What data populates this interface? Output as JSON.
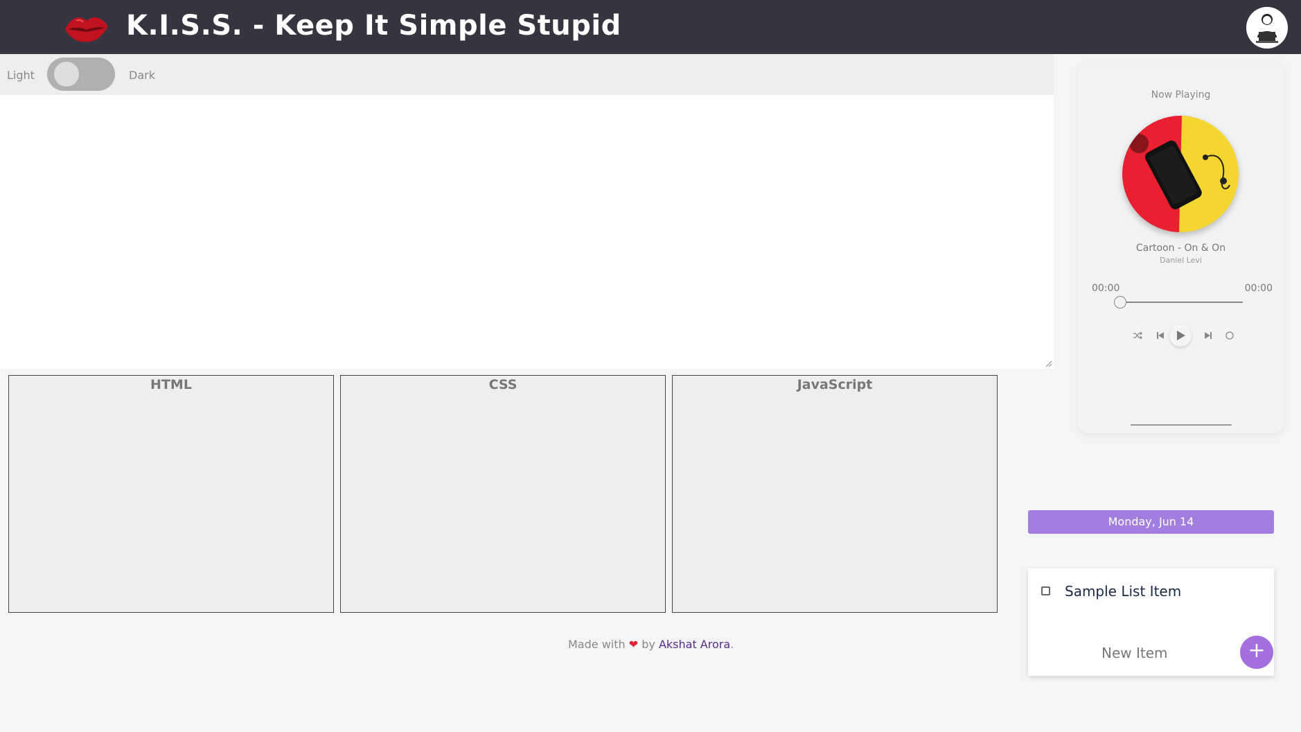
{
  "header": {
    "title": "K.I.S.S. - Keep It Simple Stupid",
    "logo_icon": "lips-icon",
    "avatar_icon": "user-laptop-avatar-icon"
  },
  "theme_toggle": {
    "light_label": "Light",
    "dark_label": "Dark",
    "state": "light"
  },
  "editors": [
    {
      "label": "HTML"
    },
    {
      "label": "CSS"
    },
    {
      "label": "JavaScript"
    }
  ],
  "footer": {
    "prefix": "Made with",
    "heart": "❤",
    "by": "by",
    "author": "Akshat Arora",
    "suffix": "."
  },
  "player": {
    "now_playing": "Now Playing",
    "song": "Cartoon - On & On",
    "artist": "Daniel Levi",
    "current_time": "00:00",
    "total_time": "00:00",
    "progress": 0,
    "controls": [
      "shuffle-icon",
      "previous-icon",
      "play-icon",
      "next-icon",
      "repeat-icon"
    ]
  },
  "todo": {
    "date": "Monday, Jun 14",
    "items": [
      {
        "label": "Sample List Item",
        "checked": false
      }
    ],
    "new_item_placeholder": "New Item",
    "add_label": "+"
  },
  "colors": {
    "header_bg": "#343541",
    "accent_purple": "#a27fde",
    "heart": "#e0263c",
    "author_link": "#5a2a8a"
  }
}
